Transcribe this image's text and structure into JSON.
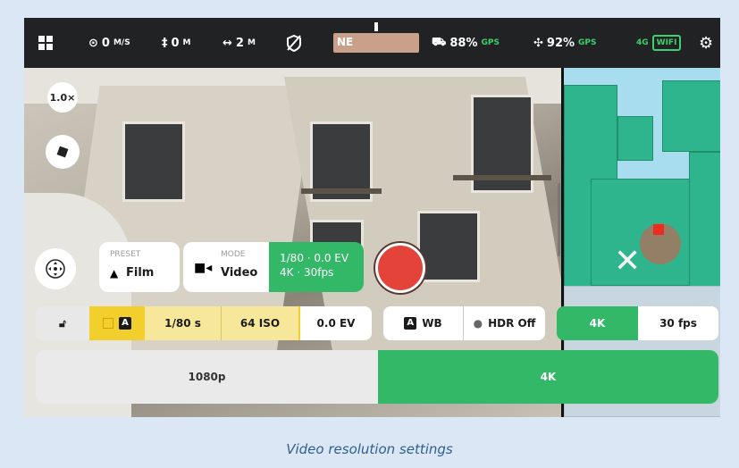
{
  "topbar": {
    "speed_value": "0",
    "speed_unit": "M/S",
    "altitude_value": "0",
    "altitude_unit": "M",
    "distance_value": "2",
    "distance_unit": "M",
    "compass_heading": "NE",
    "controller_battery": "88%",
    "controller_gps": "GPS",
    "drone_battery": "92%",
    "drone_gps": "GPS",
    "network_4g": "4G",
    "network_wifi": "WIFI"
  },
  "zoom": "1.0×",
  "preset": {
    "label": "PRESET",
    "value": "Film"
  },
  "mode": {
    "label": "MODE",
    "value": "Video",
    "shutter_ev": "1/80 · 0.0 EV",
    "resolution_fps": "4K · 30fps"
  },
  "settings_row": {
    "shutter": "1/80 s",
    "iso": "64 ISO",
    "ev": "0.0 EV",
    "wb_badge": "A",
    "wb": "WB",
    "hdr": "HDR Off",
    "resolution": "4K",
    "fps": "30 fps",
    "auto_badge": "A"
  },
  "resolution_options": [
    "1080p",
    "4K"
  ],
  "selected_resolution": "4K",
  "caption": "Video resolution settings",
  "colors": {
    "accent_green": "#33b868",
    "record_red": "#e4433a",
    "exposure_yellow": "#f7e79a"
  }
}
